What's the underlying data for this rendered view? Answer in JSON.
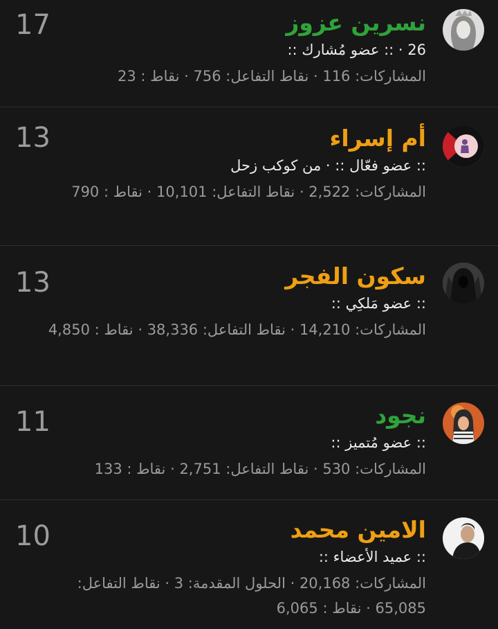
{
  "members": [
    {
      "name": "نسرين عزوز",
      "title": "26 · :: عضو مُشارك ::",
      "stats": "المشاركات: 116 · نقاط التفاعل: 756 · نقاط : 23",
      "count": "17",
      "avatar_icon": "woman-headscarf-avatar"
    },
    {
      "name": "أم إسراء",
      "title": ":: عضو فعّال :: · من كوكب زحل",
      "stats": "المشاركات: 2,522 · نقاط التفاعل: 10,101 · نقاط : 790",
      "count": "13",
      "avatar_icon": "palestine-heart-avatar"
    },
    {
      "name": "سكون الفجر",
      "title": ":: عضو مَلكِي ::",
      "stats": "المشاركات: 14,210 · نقاط التفاعل: 38,336 · نقاط : 4,850",
      "count": "13",
      "avatar_icon": "hooded-figure-avatar"
    },
    {
      "name": "نجود",
      "title": ":: عضو مُتميز ::",
      "stats": "المشاركات: 530 · نقاط التفاعل: 2,751 · نقاط : 133",
      "count": "11",
      "avatar_icon": "girl-keffiyeh-avatar"
    },
    {
      "name": "الامين محمد",
      "title": ":: عميد الأعضاء ::",
      "stats": "المشاركات: 20,168 · الحلول المقدمة: 3 · نقاط التفاعل: 65,085 · نقاط : 6,065",
      "count": "10",
      "avatar_icon": "man-portrait-avatar"
    }
  ],
  "colors": {
    "background": "#171717",
    "name_green": "#2fa33a",
    "name_orange": "#ef9f13",
    "secondary_text": "#9a9a9a"
  }
}
